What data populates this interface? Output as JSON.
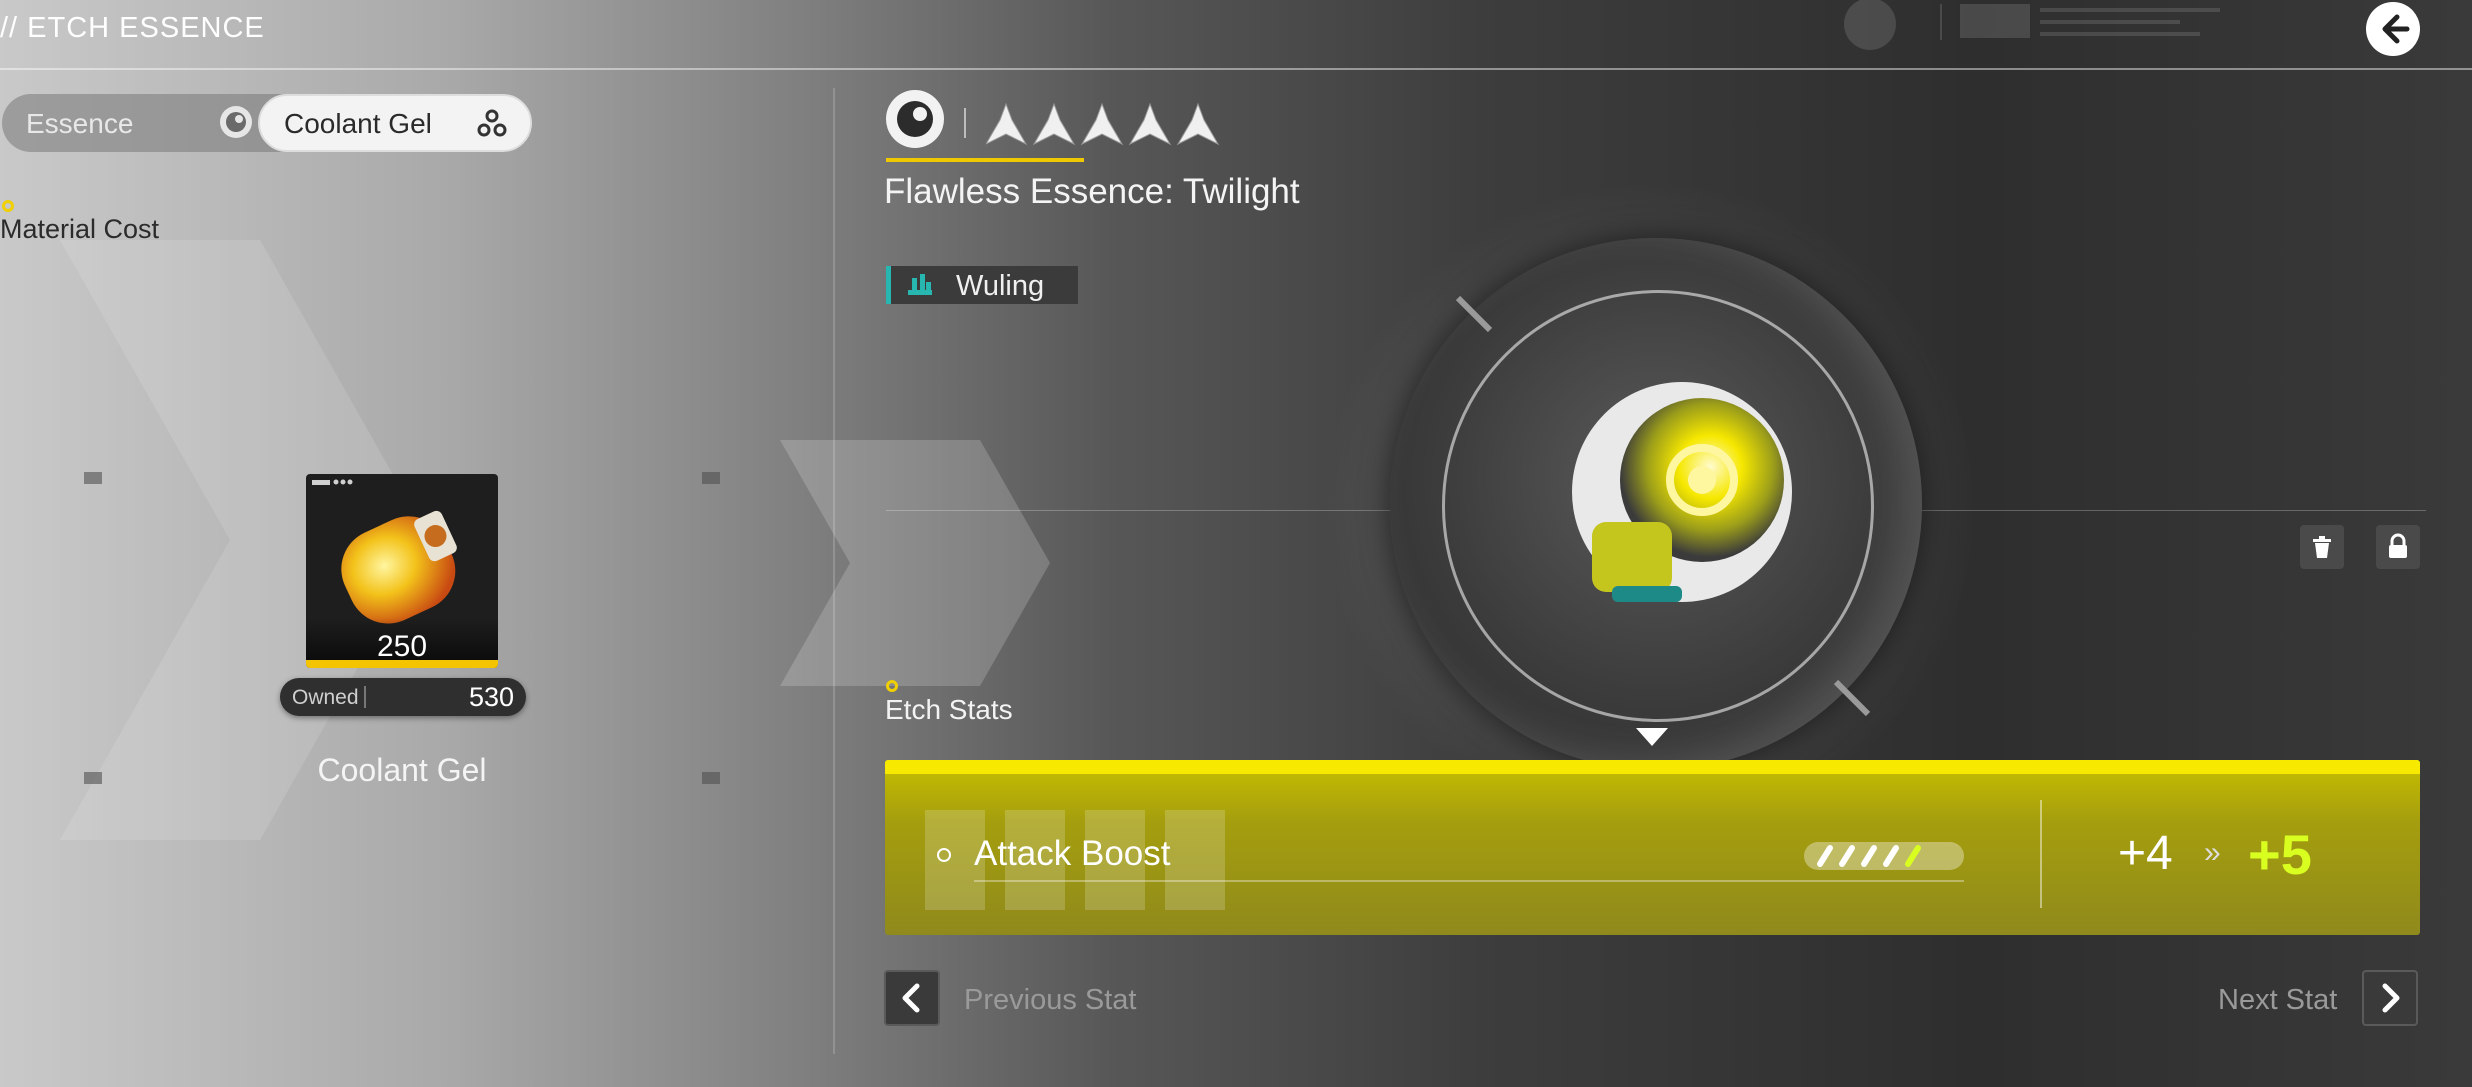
{
  "header": {
    "title": "// ETCH ESSENCE",
    "back_icon": "back-arrow-icon"
  },
  "tabs": [
    {
      "label": "Essence",
      "icon": "essence-icon",
      "selected": false
    },
    {
      "label": "Coolant Gel",
      "icon": "coolant-gel-icon",
      "selected": true
    }
  ],
  "material": {
    "section_label": "Material Cost",
    "name": "Coolant Gel",
    "quantity": "250",
    "owned_label": "Owned",
    "owned_value": "530"
  },
  "essence": {
    "name": "Flawless Essence: Twilight",
    "rarity_stars": 5,
    "faction": "Wuling",
    "accent_color": "#f0c800",
    "faction_color": "#27b6b0"
  },
  "actions": {
    "trash_icon": "trash-icon",
    "lock_icon": "lock-icon"
  },
  "stats": {
    "section_label": "Etch Stats",
    "stat_name": "Attack Boost",
    "level_pips_filled": 5,
    "level_pips_total": 5,
    "from_value": "+4",
    "arrow": "»",
    "to_value": "+5",
    "highlight_color": "#d8ff20"
  },
  "nav": {
    "prev_label": "Previous Stat",
    "next_label": "Next Stat"
  }
}
